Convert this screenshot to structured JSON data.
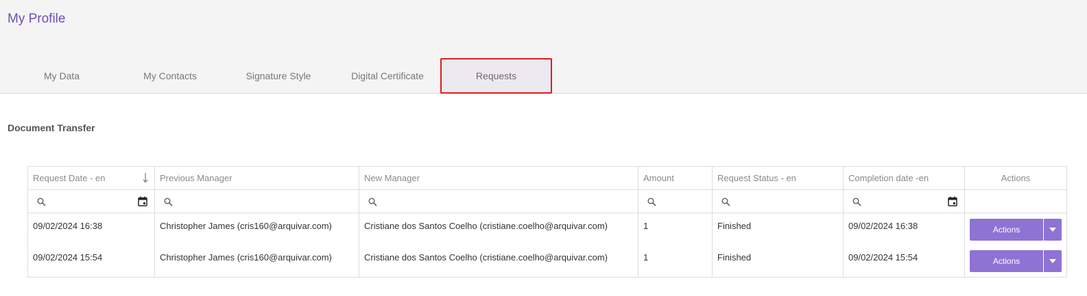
{
  "page": {
    "title": "My Profile"
  },
  "tabs": [
    {
      "label": "My Data"
    },
    {
      "label": "My Contacts"
    },
    {
      "label": "Signature Style"
    },
    {
      "label": "Digital Certificate"
    },
    {
      "label": "Requests",
      "active": true
    }
  ],
  "section": {
    "title": "Document Transfer"
  },
  "table": {
    "columns": [
      "Request Date - en",
      "Previous Manager",
      "New Manager",
      "Amount",
      "Request Status - en",
      "Completion date -en",
      "Actions"
    ],
    "sort": {
      "column": "Request Date - en",
      "direction": "descending"
    },
    "rows": [
      {
        "request_date": "09/02/2024 16:38",
        "previous_manager": "Christopher James (cris160@arquivar.com)",
        "new_manager": "Cristiane dos Santos Coelho (cristiane.coelho@arquivar.com)",
        "amount": "1",
        "status": "Finished",
        "completion_date": "09/02/2024 16:38",
        "action_label": "Actions"
      },
      {
        "request_date": "09/02/2024 15:54",
        "previous_manager": "Christopher James (cris160@arquivar.com)",
        "new_manager": "Cristiane dos Santos Coelho (cristiane.coelho@arquivar.com)",
        "amount": "1",
        "status": "Finished",
        "completion_date": "09/02/2024 15:54",
        "action_label": "Actions"
      }
    ]
  },
  "colors": {
    "title": "#6a4fb6",
    "accent_button": "#8e73d4",
    "active_tab_border": "#e01b1b",
    "active_tab_bg": "#ece9f1"
  },
  "icons": [
    "sort-arrow-down-icon",
    "search-icon",
    "calendar-icon",
    "chevron-down-icon"
  ]
}
